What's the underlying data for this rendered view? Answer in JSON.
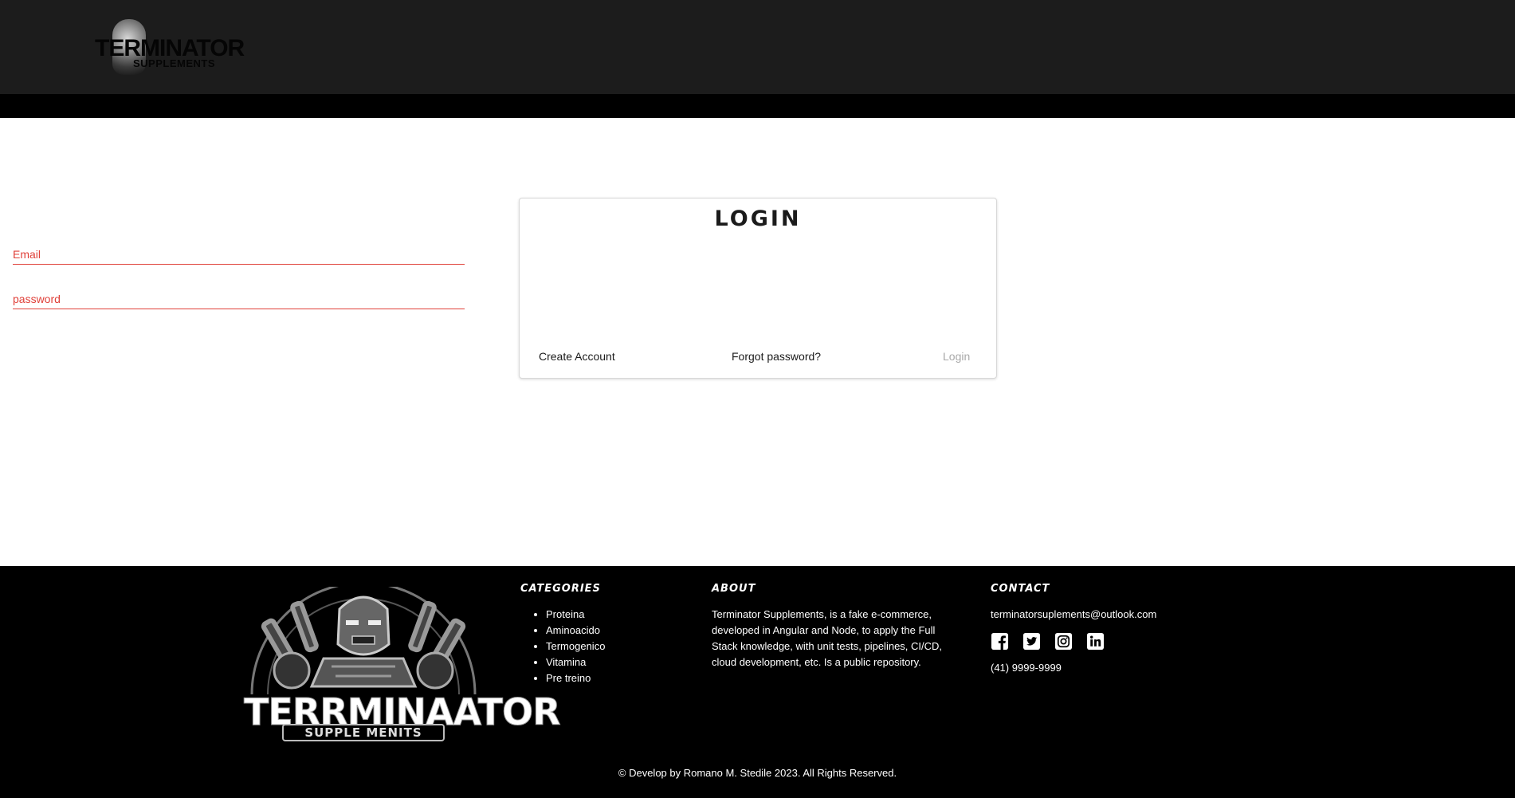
{
  "header": {
    "logo_word": "TERMINATOR",
    "logo_sub": "SUPPLEMENTS"
  },
  "login": {
    "title": "LOGIN",
    "email_placeholder": "Email",
    "password_placeholder": "password",
    "create_account": "Create Account",
    "forgot_password": "Forgot password?",
    "login_button": "Login"
  },
  "footer": {
    "logo_brand": "TERRMINAATOR",
    "logo_sub": "SUPPLE MENITS",
    "categories_heading": "CATEGORIES",
    "categories": [
      "Proteina",
      "Aminoacido",
      "Termogenico",
      "Vitamina",
      "Pre treino"
    ],
    "about_heading": "ABOUT",
    "about_text": "Terminator Supplements, is a fake e-commerce, developed in Angular and Node, to apply the Full Stack knowledge, with unit tests, pipelines, CI/CD, cloud development, etc. Is a public repository.",
    "contact_heading": "CONTACT",
    "email": "terminatorsuplements@outlook.com",
    "social_icons": [
      "facebook-icon",
      "twitter-icon",
      "instagram-icon",
      "linkedin-icon"
    ],
    "phone": "(41) 9999-9999",
    "copyright": "© Develop by Romano M. Stedile 2023. All Rights Reserved."
  },
  "colors": {
    "header_bg": "#1c1c1c",
    "nav_strip": "#000000",
    "field_error": "#e0413a",
    "login_disabled": "#a9a9a9",
    "footer_bg": "#000000"
  }
}
